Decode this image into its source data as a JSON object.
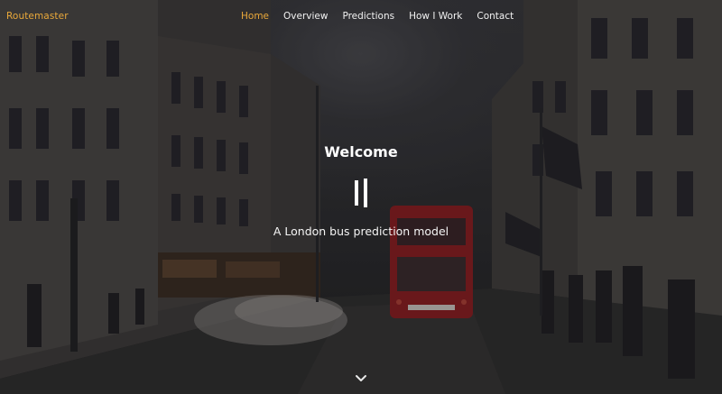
{
  "brand": {
    "name": "Routemaster"
  },
  "nav": {
    "items": [
      {
        "label": "Home",
        "active": true
      },
      {
        "label": "Overview",
        "active": false
      },
      {
        "label": "Predictions",
        "active": false
      },
      {
        "label": "How I Work",
        "active": false
      },
      {
        "label": "Contact",
        "active": false
      }
    ]
  },
  "hero": {
    "title": "Welcome",
    "subtitle": "A London bus prediction model",
    "icon": "pause-icon",
    "scroll_icon": "chevron-down-icon"
  },
  "colors": {
    "accent": "#e9a83a",
    "text": "#ffffff",
    "bus_red": "#8c1d1f"
  }
}
